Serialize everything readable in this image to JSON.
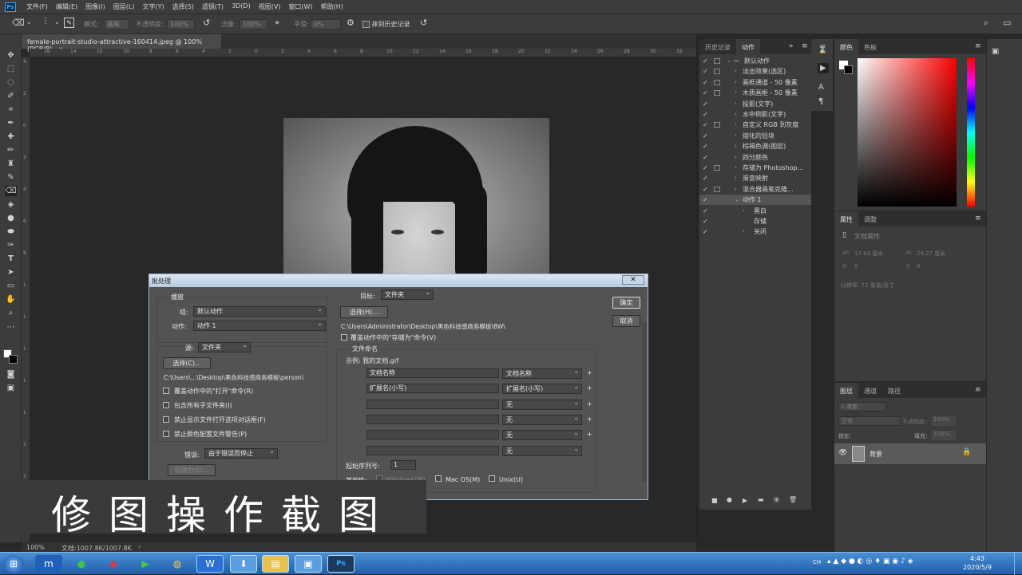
{
  "app": {
    "logo": "Ps"
  },
  "menubar": {
    "items": [
      "文件(F)",
      "编辑(E)",
      "图像(I)",
      "图层(L)",
      "文字(Y)",
      "选择(S)",
      "滤镜(T)",
      "3D(D)",
      "视图(V)",
      "窗口(W)",
      "帮助(H)"
    ]
  },
  "options": {
    "mode_label": "模式:",
    "mode_value": "画笔",
    "opacity_label": "不透明度:",
    "opacity_value": "100%",
    "flow_label": "流量:",
    "flow_value": "100%",
    "smooth_label": "平滑:",
    "smooth_value": "0%",
    "erase_history_label": "抹到历史记录"
  },
  "document": {
    "tab_title": "female-portrait-studio-attractive-160414.jpeg @ 100%(RGB/8)",
    "ruler_top": [
      "16",
      "14",
      "12",
      "10",
      "8",
      "6",
      "4",
      "2",
      "0",
      "2",
      "4",
      "6",
      "8",
      "10",
      "12",
      "14",
      "16",
      "18",
      "20",
      "22",
      "24",
      "26",
      "28",
      "30",
      "32"
    ],
    "ruler_left": [
      "4",
      "2",
      "0",
      "2",
      "4",
      "6",
      "8",
      "1",
      "1",
      "1",
      "1",
      "1",
      "2",
      "2"
    ],
    "zoom": "100%",
    "status": "文档:1007.8K/1007.8K"
  },
  "history_panel": {
    "tabs": [
      "历史记录",
      "动作"
    ],
    "actions": [
      {
        "label": "默认动作",
        "level": 0,
        "box": true,
        "arrow": "⌄",
        "folder": true
      },
      {
        "label": "淡出效果(选区)",
        "level": 1,
        "box": true,
        "arrow": "›"
      },
      {
        "label": "画框通道 - 50 像素",
        "level": 1,
        "box": true,
        "arrow": "›"
      },
      {
        "label": "木质画框 - 50 像素",
        "level": 1,
        "box": true,
        "arrow": "›"
      },
      {
        "label": "投影(文字)",
        "level": 1,
        "box": false,
        "arrow": "›"
      },
      {
        "label": "水中倒影(文字)",
        "level": 1,
        "box": false,
        "arrow": "›"
      },
      {
        "label": "自定义 RGB 到灰度",
        "level": 1,
        "box": true,
        "arrow": "›"
      },
      {
        "label": "熔化的铅块",
        "level": 1,
        "box": false,
        "arrow": "›"
      },
      {
        "label": "棕褐色调(图层)",
        "level": 1,
        "box": false,
        "arrow": "›"
      },
      {
        "label": "四分颜色",
        "level": 1,
        "box": false,
        "arrow": "›"
      },
      {
        "label": "存储为 Photoshop...",
        "level": 1,
        "box": true,
        "arrow": "›"
      },
      {
        "label": "渐变映射",
        "level": 1,
        "box": false,
        "arrow": "›"
      },
      {
        "label": "混合器画笔克隆...",
        "level": 1,
        "box": true,
        "arrow": "›"
      },
      {
        "label": "动作 1",
        "level": 1,
        "box": false,
        "arrow": "⌄",
        "selected": true
      },
      {
        "label": "黑白",
        "level": 2,
        "box": false,
        "arrow": "›"
      },
      {
        "label": "存储",
        "level": 2,
        "box": false,
        "arrow": ""
      },
      {
        "label": "关闭",
        "level": 2,
        "box": false,
        "arrow": "›"
      }
    ]
  },
  "color_panel": {
    "tabs": [
      "颜色",
      "色板"
    ]
  },
  "properties_panel": {
    "tabs": [
      "属性",
      "调整"
    ],
    "title": "文档属性",
    "w_label": "W:",
    "w_value": "17.64 厘米",
    "h_label": "H:",
    "h_value": "24.27 厘米",
    "x_label": "X:",
    "x_value": "0",
    "y_label": "Y:",
    "y_value": "0",
    "resolution": "分辨率: 72 像素/英寸"
  },
  "layers_panel": {
    "tabs": [
      "图层",
      "通道",
      "路径"
    ],
    "filter": "类型",
    "blend": "正常",
    "opacity_label": "不透明度:",
    "opacity_value": "100%",
    "lock_label": "锁定:",
    "fill_label": "填充:",
    "fill_value": "100%",
    "layer_name": "背景"
  },
  "dialog": {
    "title": "批处理",
    "close": "✕",
    "play_group": "播放",
    "set_label": "组:",
    "set_value": "默认动作",
    "action_label": "动作:",
    "action_value": "动作 1",
    "source_label": "源:",
    "source_value": "文件夹",
    "choose_source": "选择(C)...",
    "source_path": "C:\\Users\\...\\Desktop\\黑色科技感商务模板\\person\\",
    "src_opts": [
      "覆盖动作中的\"打开\"命令(R)",
      "包含所有子文件夹(I)",
      "禁止显示文件打开选项对话框(F)",
      "禁止颜色配置文件警告(P)"
    ],
    "error_label": "错误:",
    "error_value": "由于错误而停止",
    "save_as": "存储为(E)...",
    "dest_label": "目标:",
    "dest_value": "文件夹",
    "choose_dest": "选择(H)...",
    "dest_path": "C:\\Users\\Administrator\\Desktop\\黑色科技感商务模板\\BW\\",
    "override_save": "覆盖动作中的\"存储为\"命令(V)",
    "naming_group": "文件命名",
    "example": "示例: 我的文档.gif",
    "naming_rows": [
      {
        "field": "文档名称",
        "select": "文档名称"
      },
      {
        "field": "扩展名(小写)",
        "select": "扩展名(小写)"
      },
      {
        "field": "",
        "select": "无"
      },
      {
        "field": "",
        "select": "无"
      },
      {
        "field": "",
        "select": "无"
      },
      {
        "field": "",
        "select": "无"
      }
    ],
    "serial_label": "起始序列号:",
    "serial_value": "1",
    "compat_label": "兼容性:",
    "compat_windows": "Windows(W)",
    "compat_mac": "Mac OS(M)",
    "compat_unix": "Unix(U)",
    "ok": "确定",
    "cancel": "取消"
  },
  "caption": {
    "text": "修图操作截图"
  },
  "taskbar": {
    "time": "4:43",
    "date": "2020/5/9",
    "ime": "CH"
  }
}
